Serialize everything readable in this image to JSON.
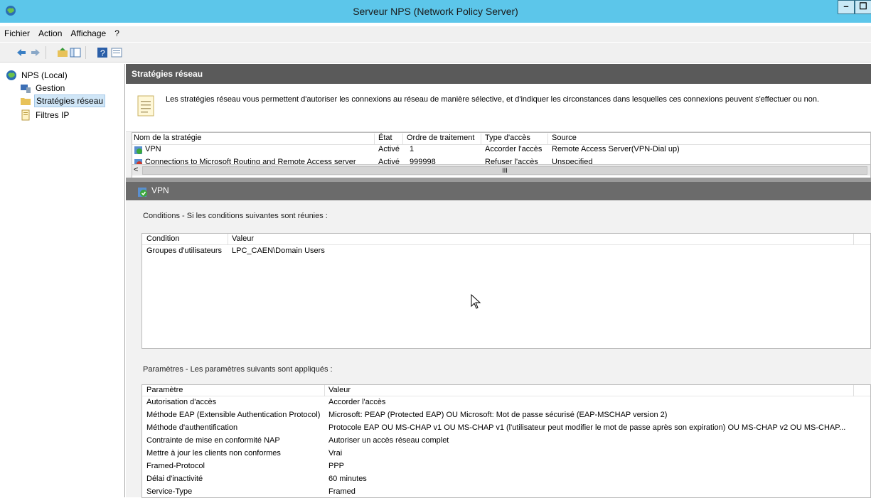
{
  "window": {
    "title": "Serveur NPS (Network Policy Server)",
    "min_label": "–",
    "max_label": "☐"
  },
  "menu": {
    "file": "Fichier",
    "action": "Action",
    "view": "Affichage",
    "help": "?"
  },
  "toolbar": {
    "icons": [
      "back-arrow-icon",
      "forward-arrow-icon",
      "up-folder-icon",
      "show-hide-tree-icon",
      "help-icon",
      "properties-icon"
    ]
  },
  "tree": {
    "root": "NPS (Local)",
    "items": [
      "Gestion",
      "Stratégies réseau",
      "Filtres IP"
    ]
  },
  "main": {
    "header": "Stratégies réseau",
    "info": "Les stratégies réseau vous permettent d'autoriser les connexions au réseau de manière sélective, et d'indiquer les circonstances dans lesquelles ces connexions peuvent s'effectuer ou non.",
    "columns": [
      "Nom de la stratégie",
      "État",
      "Ordre de traitement",
      "Type d'accès",
      "Source"
    ],
    "policies": [
      {
        "name": "VPN",
        "state": "Activé",
        "order": "1",
        "access": "Accorder l'accès",
        "source": "Remote Access Server(VPN-Dial up)"
      },
      {
        "name": "Connections to Microsoft Routing and Remote Access server",
        "state": "Activé",
        "order": "999998",
        "access": "Refuser l'accès",
        "source": "Unspecified"
      }
    ],
    "scroll_thumb": "III",
    "scroll_left": "<"
  },
  "detail": {
    "title": "VPN",
    "conditions_title": "Conditions - Si les conditions suivantes sont réunies :",
    "conditions_columns": [
      "Condition",
      "Valeur"
    ],
    "conditions": [
      {
        "name": "Groupes d'utilisateurs",
        "value": "LPC_CAEN\\Domain Users"
      }
    ],
    "params_title": "Paramètres - Les paramètres suivants sont appliqués :",
    "params_columns": [
      "Paramètre",
      "Valeur"
    ],
    "params": [
      {
        "name": "Autorisation d'accès",
        "value": "Accorder l'accès"
      },
      {
        "name": "Méthode EAP (Extensible Authentication Protocol)",
        "value": "Microsoft: PEAP (Protected EAP) OU Microsoft: Mot de passe sécurisé (EAP-MSCHAP version 2)"
      },
      {
        "name": "Méthode d'authentification",
        "value": "Protocole EAP OU MS-CHAP v1 OU MS-CHAP v1 (l'utilisateur peut modifier le mot de passe après son expiration) OU MS-CHAP v2 OU MS-CHAP..."
      },
      {
        "name": "Contrainte de mise en conformité NAP",
        "value": "Autoriser un accès réseau complet"
      },
      {
        "name": "Mettre à jour les clients non conformes",
        "value": "Vrai"
      },
      {
        "name": "Framed-Protocol",
        "value": "PPP"
      },
      {
        "name": "Délai d'inactivité",
        "value": "60 minutes"
      },
      {
        "name": "Service-Type",
        "value": "Framed"
      }
    ]
  }
}
